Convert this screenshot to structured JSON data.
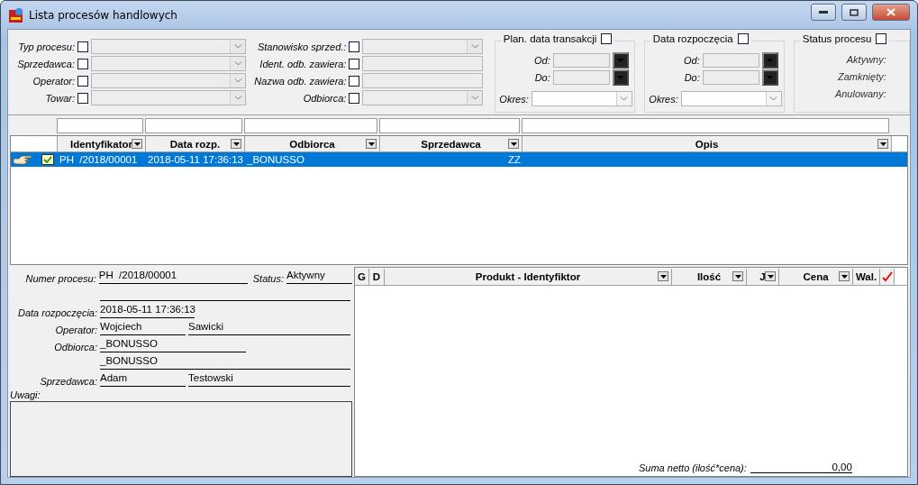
{
  "window": {
    "title": "Lista procesów handlowych"
  },
  "filters": {
    "left": [
      {
        "label": "Typ procesu:",
        "checked": false,
        "kind": "combo"
      },
      {
        "label": "Sprzedawca:",
        "checked": false,
        "kind": "combo"
      },
      {
        "label": "Operator:",
        "checked": false,
        "kind": "combo"
      },
      {
        "label": "Towar:",
        "checked": false,
        "kind": "combo"
      }
    ],
    "right": [
      {
        "label": "Stanowisko sprzed.:",
        "checked": false,
        "kind": "combo"
      },
      {
        "label": "Ident. odb. zawiera:",
        "checked": false,
        "kind": "text"
      },
      {
        "label": "Nazwa odb. zawiera:",
        "checked": false,
        "kind": "text"
      },
      {
        "label": "Odbiorca:",
        "checked": false,
        "kind": "combo"
      }
    ]
  },
  "date_groups": [
    {
      "title": "Plan. data transakcji",
      "checked": false,
      "from_label": "Od:",
      "to_label": "Do:",
      "period_label": "Okres:"
    },
    {
      "title": "Data rozpoczęcia",
      "checked": false,
      "from_label": "Od:",
      "to_label": "Do:",
      "period_label": "Okres:"
    }
  ],
  "status_group": {
    "title": "Status procesu",
    "checked": false,
    "options": [
      "Aktywny:",
      "Zamknięty:",
      "Anulowany:"
    ]
  },
  "table": {
    "columns": [
      {
        "label": "Identyfikator",
        "dropdown": true
      },
      {
        "label": "Data rozp.",
        "dropdown": true
      },
      {
        "label": "Odbiorca",
        "dropdown": true
      },
      {
        "label": "Sprzedawca",
        "dropdown": true
      },
      {
        "label": "Opis",
        "dropdown": true
      }
    ],
    "rows": [
      {
        "selected": true,
        "cells": [
          "PH  /2018/00001",
          "2018-05-11 17:36:13",
          "_BONUSSO",
          "ZZ",
          ""
        ]
      }
    ]
  },
  "details": {
    "rows": [
      {
        "kind": "number",
        "label": "Numer procesu:",
        "values": [
          "PH  /2018/00001"
        ],
        "status_label": "Status:",
        "status_value": "Aktywny"
      },
      {
        "kind": "wide",
        "label": "",
        "values": []
      },
      {
        "kind": "short",
        "label": "Data rozpoczęcia:",
        "values": [
          "2018-05-11 17:36:13"
        ]
      },
      {
        "kind": "split",
        "label": "Operator:",
        "values": [
          "Wojciech",
          "Sawicki"
        ]
      },
      {
        "kind": "half",
        "label": "Odbiorca:",
        "values": [
          "_BONUSSO"
        ]
      },
      {
        "kind": "wide",
        "label": "",
        "values": [
          "_BONUSSO"
        ]
      },
      {
        "kind": "split",
        "label": "Sprzedawca:",
        "values": [
          "Adam",
          "Testowski"
        ]
      }
    ],
    "notes_label": "Uwagi:"
  },
  "items": {
    "columns": [
      {
        "label": "G",
        "dropdown": false
      },
      {
        "label": "D",
        "dropdown": false
      },
      {
        "label": "Produkt - Identyfiktor",
        "dropdown": true
      },
      {
        "label": "Ilość",
        "dropdown": true
      },
      {
        "label": "J",
        "dropdown": true
      },
      {
        "label": "Cena",
        "dropdown": true
      },
      {
        "label": "Wal.",
        "dropdown": false
      }
    ],
    "total_label": "Suma netto (ilość*cena):",
    "total_value": "0,00"
  }
}
